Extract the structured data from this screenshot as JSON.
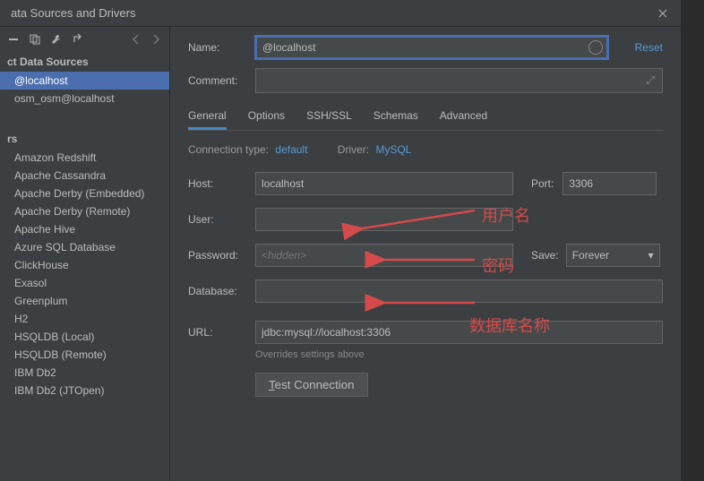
{
  "titlebar": {
    "title": "ata Sources and Drivers"
  },
  "sidebar": {
    "sources_header": "ct Data Sources",
    "sources": [
      {
        "label": "@localhost",
        "active": true
      },
      {
        "label": "osm_osm@localhost",
        "active": false
      }
    ],
    "drivers_header": "rs",
    "drivers": [
      "Amazon Redshift",
      "Apache Cassandra",
      "Apache Derby (Embedded)",
      "Apache Derby (Remote)",
      "Apache Hive",
      "Azure SQL Database",
      "ClickHouse",
      "Exasol",
      "Greenplum",
      "H2",
      "HSQLDB (Local)",
      "HSQLDB (Remote)",
      "IBM Db2",
      "IBM Db2 (JTOpen)"
    ]
  },
  "form": {
    "name_label": "Name:",
    "name_value": "@localhost",
    "reset_label": "Reset",
    "comment_label": "Comment:",
    "comment_value": "",
    "tabs": [
      "General",
      "Options",
      "SSH/SSL",
      "Schemas",
      "Advanced"
    ],
    "conn_type_label": "Connection type:",
    "conn_type_value": "default",
    "driver_label": "Driver:",
    "driver_value": "MySQL",
    "host_label": "Host:",
    "host_value": "localhost",
    "port_label": "Port:",
    "port_value": "3306",
    "user_label": "User:",
    "user_value": "",
    "password_label": "Password:",
    "password_placeholder": "<hidden>",
    "save_label": "Save:",
    "save_value": "Forever",
    "database_label": "Database:",
    "database_value": "",
    "url_label": "URL:",
    "url_value": "jdbc:mysql://localhost:3306",
    "url_hint": "Overrides settings above",
    "test_button": "Test Connection",
    "test_underline": "T"
  },
  "annotations": {
    "user": "用户名",
    "password": "密码",
    "database": "数据库名称"
  }
}
